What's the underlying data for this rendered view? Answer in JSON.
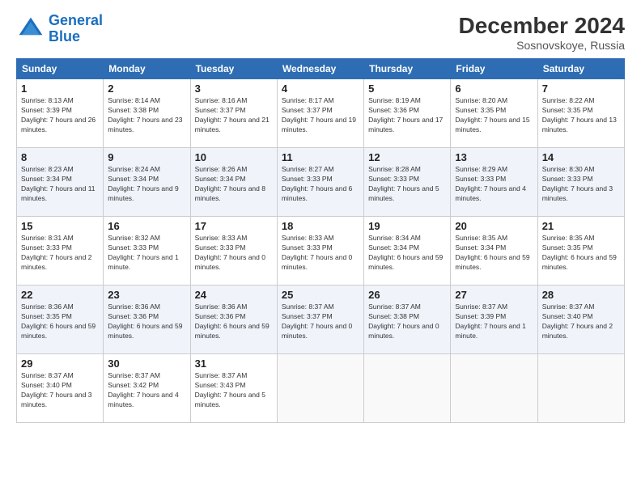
{
  "header": {
    "logo_line1": "General",
    "logo_line2": "Blue",
    "month_title": "December 2024",
    "location": "Sosnovskoye, Russia"
  },
  "days_of_week": [
    "Sunday",
    "Monday",
    "Tuesday",
    "Wednesday",
    "Thursday",
    "Friday",
    "Saturday"
  ],
  "weeks": [
    [
      {
        "day": "1",
        "sunrise": "8:13 AM",
        "sunset": "3:39 PM",
        "daylight": "7 hours and 26 minutes."
      },
      {
        "day": "2",
        "sunrise": "8:14 AM",
        "sunset": "3:38 PM",
        "daylight": "7 hours and 23 minutes."
      },
      {
        "day": "3",
        "sunrise": "8:16 AM",
        "sunset": "3:37 PM",
        "daylight": "7 hours and 21 minutes."
      },
      {
        "day": "4",
        "sunrise": "8:17 AM",
        "sunset": "3:37 PM",
        "daylight": "7 hours and 19 minutes."
      },
      {
        "day": "5",
        "sunrise": "8:19 AM",
        "sunset": "3:36 PM",
        "daylight": "7 hours and 17 minutes."
      },
      {
        "day": "6",
        "sunrise": "8:20 AM",
        "sunset": "3:35 PM",
        "daylight": "7 hours and 15 minutes."
      },
      {
        "day": "7",
        "sunrise": "8:22 AM",
        "sunset": "3:35 PM",
        "daylight": "7 hours and 13 minutes."
      }
    ],
    [
      {
        "day": "8",
        "sunrise": "8:23 AM",
        "sunset": "3:34 PM",
        "daylight": "7 hours and 11 minutes."
      },
      {
        "day": "9",
        "sunrise": "8:24 AM",
        "sunset": "3:34 PM",
        "daylight": "7 hours and 9 minutes."
      },
      {
        "day": "10",
        "sunrise": "8:26 AM",
        "sunset": "3:34 PM",
        "daylight": "7 hours and 8 minutes."
      },
      {
        "day": "11",
        "sunrise": "8:27 AM",
        "sunset": "3:33 PM",
        "daylight": "7 hours and 6 minutes."
      },
      {
        "day": "12",
        "sunrise": "8:28 AM",
        "sunset": "3:33 PM",
        "daylight": "7 hours and 5 minutes."
      },
      {
        "day": "13",
        "sunrise": "8:29 AM",
        "sunset": "3:33 PM",
        "daylight": "7 hours and 4 minutes."
      },
      {
        "day": "14",
        "sunrise": "8:30 AM",
        "sunset": "3:33 PM",
        "daylight": "7 hours and 3 minutes."
      }
    ],
    [
      {
        "day": "15",
        "sunrise": "8:31 AM",
        "sunset": "3:33 PM",
        "daylight": "7 hours and 2 minutes."
      },
      {
        "day": "16",
        "sunrise": "8:32 AM",
        "sunset": "3:33 PM",
        "daylight": "7 hours and 1 minute."
      },
      {
        "day": "17",
        "sunrise": "8:33 AM",
        "sunset": "3:33 PM",
        "daylight": "7 hours and 0 minutes."
      },
      {
        "day": "18",
        "sunrise": "8:33 AM",
        "sunset": "3:33 PM",
        "daylight": "7 hours and 0 minutes."
      },
      {
        "day": "19",
        "sunrise": "8:34 AM",
        "sunset": "3:34 PM",
        "daylight": "6 hours and 59 minutes."
      },
      {
        "day": "20",
        "sunrise": "8:35 AM",
        "sunset": "3:34 PM",
        "daylight": "6 hours and 59 minutes."
      },
      {
        "day": "21",
        "sunrise": "8:35 AM",
        "sunset": "3:35 PM",
        "daylight": "6 hours and 59 minutes."
      }
    ],
    [
      {
        "day": "22",
        "sunrise": "8:36 AM",
        "sunset": "3:35 PM",
        "daylight": "6 hours and 59 minutes."
      },
      {
        "day": "23",
        "sunrise": "8:36 AM",
        "sunset": "3:36 PM",
        "daylight": "6 hours and 59 minutes."
      },
      {
        "day": "24",
        "sunrise": "8:36 AM",
        "sunset": "3:36 PM",
        "daylight": "6 hours and 59 minutes."
      },
      {
        "day": "25",
        "sunrise": "8:37 AM",
        "sunset": "3:37 PM",
        "daylight": "7 hours and 0 minutes."
      },
      {
        "day": "26",
        "sunrise": "8:37 AM",
        "sunset": "3:38 PM",
        "daylight": "7 hours and 0 minutes."
      },
      {
        "day": "27",
        "sunrise": "8:37 AM",
        "sunset": "3:39 PM",
        "daylight": "7 hours and 1 minute."
      },
      {
        "day": "28",
        "sunrise": "8:37 AM",
        "sunset": "3:40 PM",
        "daylight": "7 hours and 2 minutes."
      }
    ],
    [
      {
        "day": "29",
        "sunrise": "8:37 AM",
        "sunset": "3:40 PM",
        "daylight": "7 hours and 3 minutes."
      },
      {
        "day": "30",
        "sunrise": "8:37 AM",
        "sunset": "3:42 PM",
        "daylight": "7 hours and 4 minutes."
      },
      {
        "day": "31",
        "sunrise": "8:37 AM",
        "sunset": "3:43 PM",
        "daylight": "7 hours and 5 minutes."
      },
      null,
      null,
      null,
      null
    ]
  ]
}
